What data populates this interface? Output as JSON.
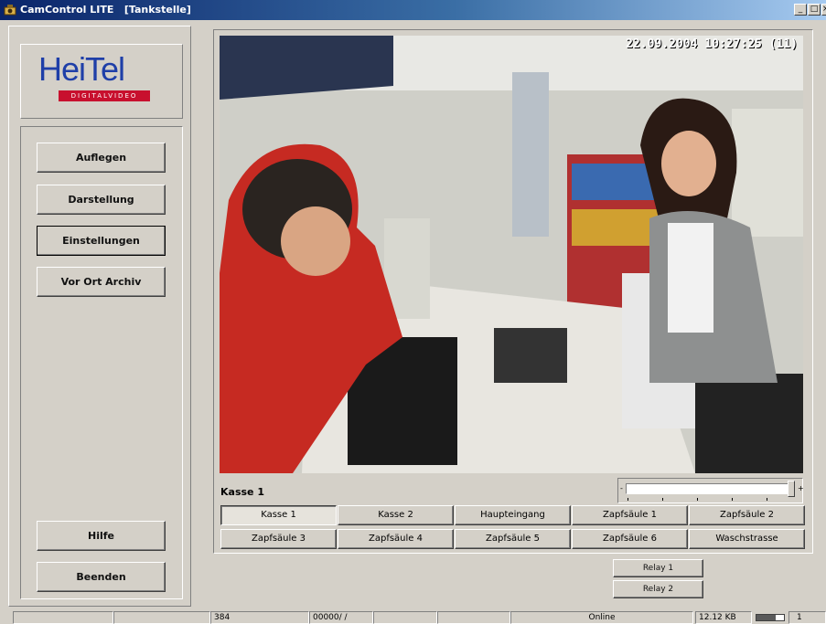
{
  "window": {
    "title": "CamControl LITE   [Tankstelle]",
    "minimize": "_",
    "maximize": "□",
    "close": "×"
  },
  "logo": {
    "name": "HeiTel",
    "tagline": "DIGITALVIDEO"
  },
  "sidebar": {
    "buttons": [
      "Auflegen",
      "Darstellung",
      "Einstellungen",
      "Vor Ort Archiv"
    ],
    "help": "Hilfe",
    "exit": "Beenden"
  },
  "video": {
    "timestamp": "22.09.2004 10:27:25 (11)",
    "camera_label": "Kasse 1"
  },
  "cameras": {
    "row1": [
      "Kasse 1",
      "Kasse 2",
      "Haupteingang",
      "Zapfsäule 1",
      "Zapfsäule 2"
    ],
    "row2": [
      "Zapfsäule 3",
      "Zapfsäule 4",
      "Zapfsäule 5",
      "Zapfsäule 6",
      "Waschstrasse"
    ],
    "selected": "Kasse 1"
  },
  "slider": {
    "left_mark": "-",
    "right_mark": "+",
    "level": 1.0
  },
  "relays": [
    "Relay 1",
    "Relay 2"
  ],
  "status": {
    "c1": "",
    "c2": "",
    "c3": "384",
    "c4": "00000/   /",
    "c5": "",
    "c6": "",
    "online": "Online",
    "kb": "12.12 KB",
    "count": "1",
    "meter_level": 0.7
  },
  "colors": {
    "titlebar": "#0a246a",
    "logo_blue": "#1f3fa8",
    "logo_red": "#c8102e",
    "face": "#d4d0c8"
  }
}
